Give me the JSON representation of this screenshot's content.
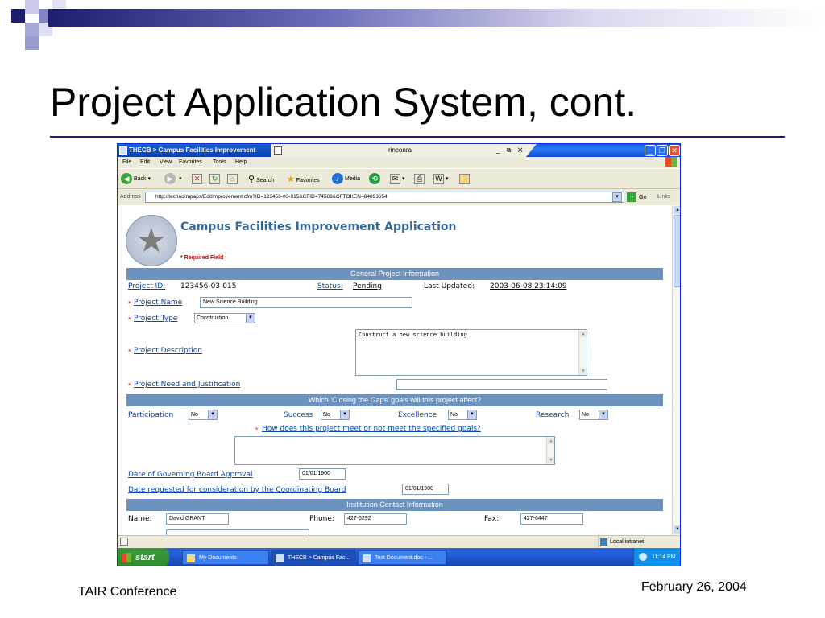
{
  "slide": {
    "title": "Project Application System, cont.",
    "footer_left": "TAIR Conference",
    "footer_right": "February 26, 2004"
  },
  "browser": {
    "tab_active": "THECB > Campus Facilities Improvement",
    "tab_user": "rinconra",
    "tab_controls": "_ ⧉ ✕",
    "menu": [
      "File",
      "Edit",
      "View",
      "Favorites",
      "Tools",
      "Help"
    ],
    "toolbar": {
      "back": "Back",
      "search": "Search",
      "favorites": "Favorites",
      "media": "Media"
    },
    "address_label": "Address",
    "address_url": "http://techno/mpaps/EditImprovement.cfm?ID=123456-03-015&CFID=74588&CFTOKEN=84893654",
    "go": "Go",
    "links": "Links"
  },
  "page": {
    "app_title": "Campus Facilities Improvement Application",
    "required_note": "* Required Field",
    "section_general": "General Project Information",
    "project_id_label": "Project ID:",
    "project_id_value": "123456-03-015",
    "status_label": "Status:",
    "status_value": "Pending",
    "last_updated_label": "Last Updated:",
    "last_updated_value": "2003-06-08 23:14:09",
    "project_name_label": "Project Name",
    "project_name_value": "New Science Building",
    "project_type_label": "Project Type",
    "project_type_value": "Construction",
    "project_description_label": "Project Description",
    "project_description_value": "Construct a new science building",
    "need_label": "Project Need and Justification",
    "need_value": "",
    "section_goals": "Which 'Closing the Gaps' goals will this project affect?",
    "goals": [
      {
        "label": "Participation",
        "value": "No"
      },
      {
        "label": "Success",
        "value": "No"
      },
      {
        "label": "Excellence",
        "value": "No"
      },
      {
        "label": "Research",
        "value": "No"
      }
    ],
    "goals_question": "How does this project meet or not meet the specified goals?",
    "goals_answer": "",
    "board_approval_label": "Date of Governing Board Approval",
    "board_approval_value": "01/01/1900",
    "coord_board_label": "Date requested for consideration by the Coordinating Board",
    "coord_board_value": "01/01/1900",
    "section_contact": "Institution Contact Information",
    "name_label": "Name:",
    "name_value": "David GRANT",
    "phone_label": "Phone:",
    "phone_value": "427-6292",
    "fax_label": "Fax:",
    "fax_value": "427-6447",
    "required_mark": "*"
  },
  "statusbar": {
    "zone": "Local intranet"
  },
  "taskbar": {
    "start": "start",
    "tasks": [
      "My Documents",
      "THECB > Campus Fac...",
      "Test Document.doc - ..."
    ],
    "clock": "11:14 PM"
  },
  "colors": {
    "section_header": "#6d92bd",
    "link": "#0645ad",
    "required": "#cc0000",
    "title_rule": "#1e1e6e",
    "app_title": "#336699"
  }
}
